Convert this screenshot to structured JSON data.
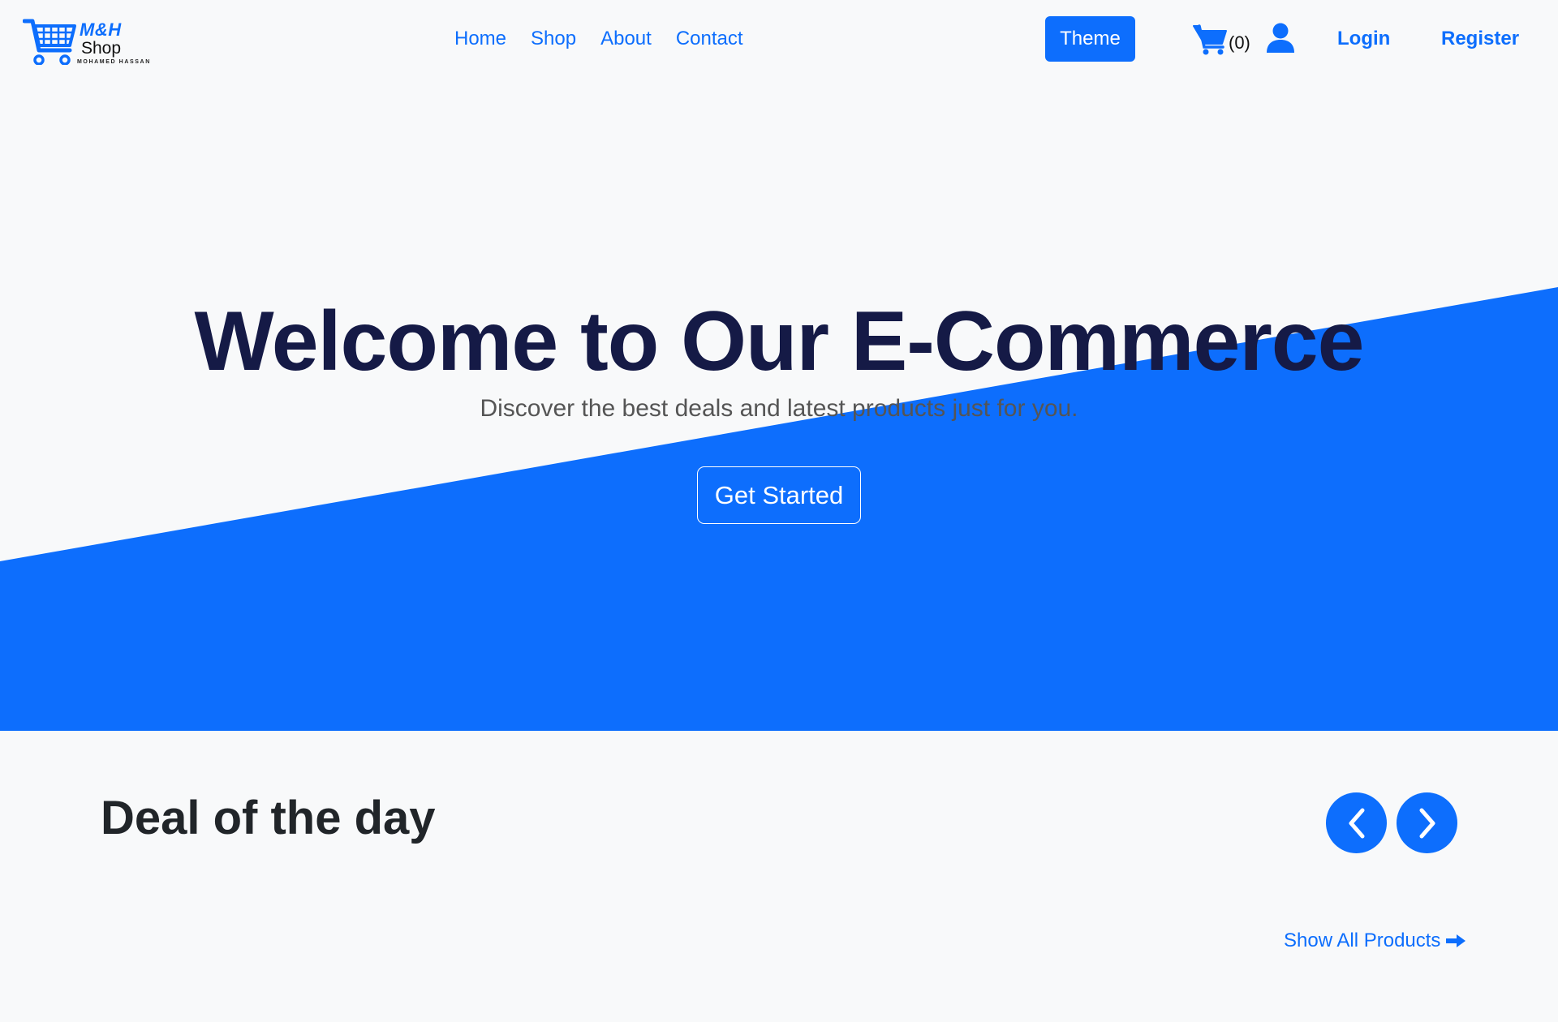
{
  "brand": {
    "name": "M&H",
    "subtitle": "Shop",
    "tagline": "MOHAMED HASSAN",
    "logo_icon": "shopping-cart-icon"
  },
  "nav": {
    "links": [
      "Home",
      "Shop",
      "About",
      "Contact"
    ],
    "theme_label": "Theme",
    "cart_icon": "shopping-cart-icon",
    "cart_count": "(0)",
    "user_icon": "user-icon",
    "login_label": "Login",
    "register_label": "Register"
  },
  "hero": {
    "title": "Welcome to Our E-Commerce",
    "subtitle": "Discover the best deals and latest products just for you.",
    "cta_label": "Get Started"
  },
  "deals": {
    "title": "Deal of the day",
    "prev_icon": "chevron-left-icon",
    "next_icon": "chevron-right-icon",
    "show_all_label": "Show All Products",
    "show_all_icon": "arrow-right-icon"
  },
  "colors": {
    "accent": "#0d6efd",
    "background": "#f8f9fa",
    "hero_title": "#151a46",
    "text_dark": "#212529"
  }
}
